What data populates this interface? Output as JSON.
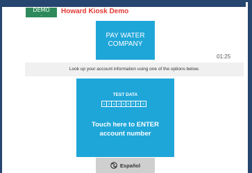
{
  "colors": {
    "frame": "#26456f",
    "accent_tile": "#1fa6d9",
    "demo_badge": "#2f8a5b",
    "demo_title": "#e53935",
    "instruction_bg": "#f0f0f0",
    "language_button_bg": "#cfcfcf"
  },
  "header": {
    "demo_label": "DEMO",
    "demo_sub": "...",
    "title": "Howard Kiosk Demo"
  },
  "logo": {
    "line1": "PAY WATER",
    "line2": "COMPANY"
  },
  "timer": "01:25",
  "instruction": "Look up your account information using one of the options below.",
  "enter_tile": {
    "test_label": "TEST DATA",
    "digits": [
      "1",
      "2",
      "3",
      "4",
      "5",
      "6",
      "7",
      "8",
      "9"
    ],
    "line1": "Touch here to ENTER",
    "line2": "account number"
  },
  "language_button": {
    "icon": "globe-icon",
    "label": "Español"
  }
}
